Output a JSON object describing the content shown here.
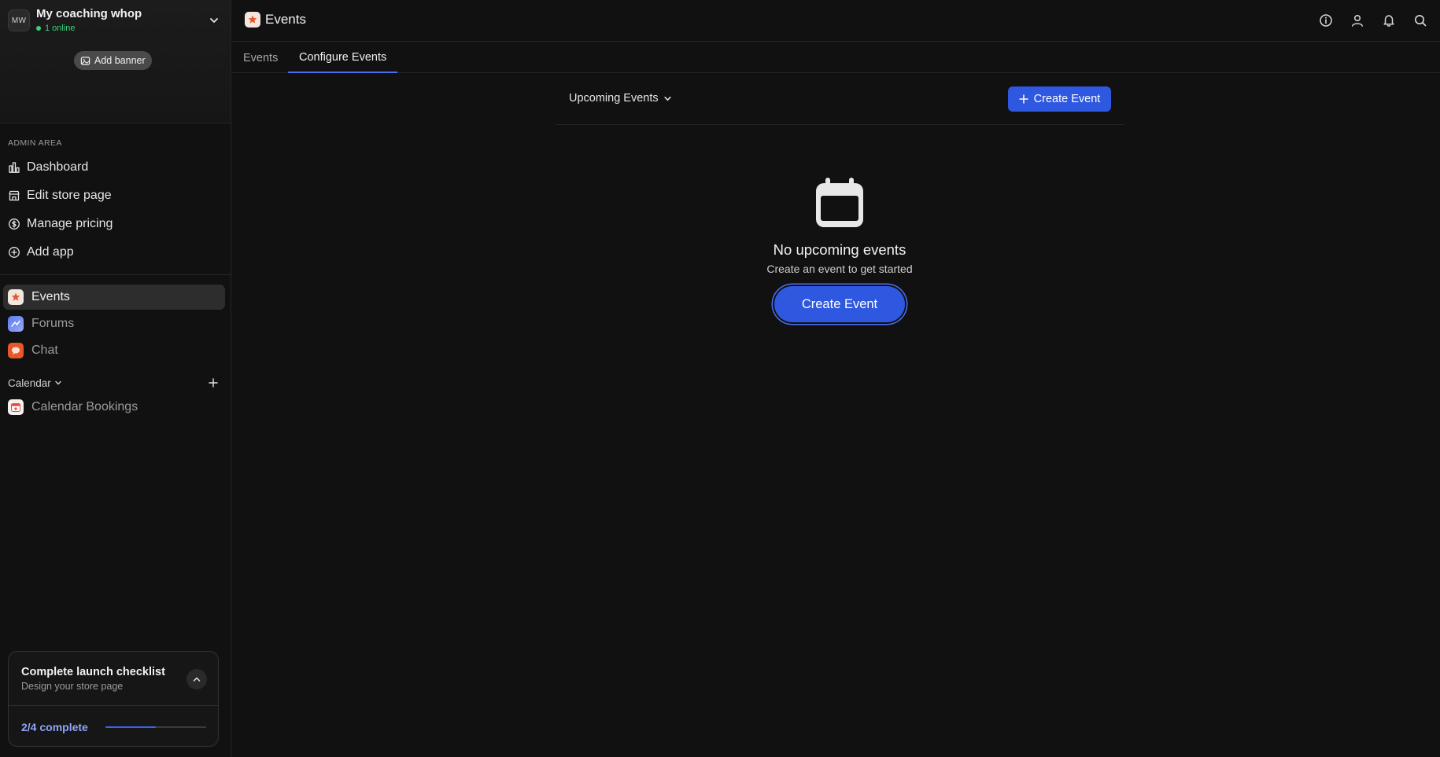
{
  "workspace": {
    "avatar_initials": "MW",
    "name": "My coaching whop",
    "online_status": "1 online",
    "add_banner_label": "Add banner"
  },
  "sidebar": {
    "admin_section_label": "ADMIN AREA",
    "admin_items": [
      {
        "label": "Dashboard",
        "icon": "chart-icon"
      },
      {
        "label": "Edit store page",
        "icon": "store-icon"
      },
      {
        "label": "Manage pricing",
        "icon": "dollar-circle-icon"
      },
      {
        "label": "Add app",
        "icon": "plus-circle-icon"
      }
    ],
    "apps": [
      {
        "label": "Events",
        "icon": "events-app-icon",
        "active": true
      },
      {
        "label": "Forums",
        "icon": "forums-app-icon",
        "active": false
      },
      {
        "label": "Chat",
        "icon": "chat-app-icon",
        "active": false
      }
    ],
    "calendar_section_label": "Calendar",
    "calendar_apps": [
      {
        "label": "Calendar Bookings",
        "icon": "calendar-bookings-app-icon"
      }
    ]
  },
  "checklist": {
    "title": "Complete launch checklist",
    "subtitle": "Design your store page",
    "progress_text": "2/4 complete",
    "progress_fraction": 0.5
  },
  "header": {
    "title": "Events",
    "actions": [
      "info-icon",
      "user-icon",
      "bell-icon",
      "search-icon"
    ]
  },
  "tabs": [
    {
      "label": "Events",
      "active": false
    },
    {
      "label": "Configure Events",
      "active": true
    }
  ],
  "content": {
    "filter_label": "Upcoming Events",
    "create_button_label": "Create Event",
    "empty_title": "No upcoming events",
    "empty_subtitle": "Create an event to get started",
    "empty_button_label": "Create Event"
  },
  "colors": {
    "accent": "#2f58e0",
    "online": "#3fcf7b",
    "progress_text": "#8fa6f5"
  }
}
